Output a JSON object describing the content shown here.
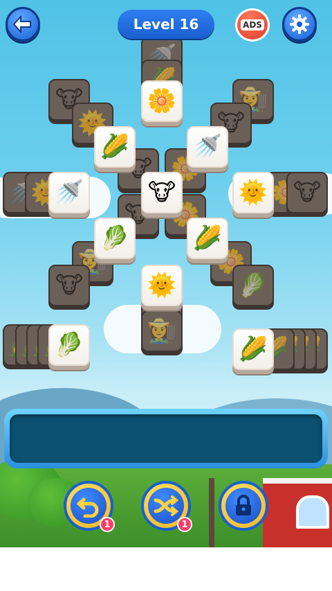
{
  "header": {
    "level_label": "Level 16",
    "ads_label": "ADS",
    "back_icon": "back-arrow-icon",
    "settings_icon": "gear-icon"
  },
  "board": {
    "tiles_top": [
      "flower",
      "corn",
      "watering-can",
      "watering-can",
      "cow",
      "sun",
      "cabbage",
      "corn",
      "sun",
      "cabbage",
      "corn"
    ],
    "tile_types": {
      "cow": "🐮",
      "sun": "🌞",
      "corn": "🌽",
      "flower": "🌼",
      "cabbage": "🥬",
      "watering-can": "🚿",
      "farmer": "👩‍🌾"
    }
  },
  "tools": {
    "undo": {
      "icon": "undo-icon",
      "count": "1"
    },
    "shuffle": {
      "icon": "shuffle-icon",
      "count": "1"
    },
    "locked": {
      "icon": "lock-icon"
    }
  },
  "colors": {
    "sky": "#4fc2e6",
    "tray_border": "#2a8fe0",
    "tray_fill": "#0b5070",
    "button_blue": "#1b5fd6",
    "badge": "#ff3b6b"
  }
}
